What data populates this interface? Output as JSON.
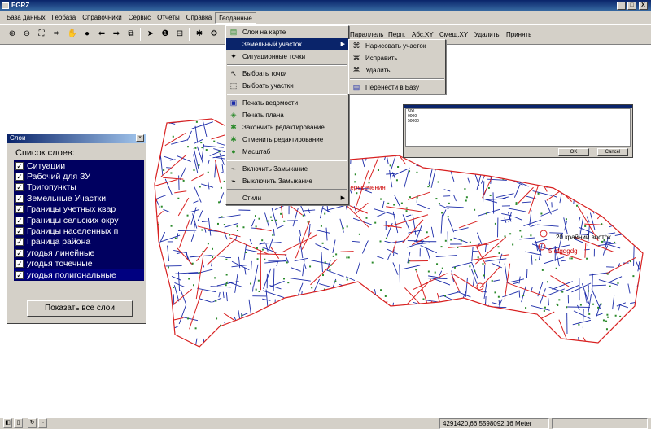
{
  "window": {
    "title": "EGRZ",
    "min_label": "_",
    "max_label": "□",
    "close_label": "X"
  },
  "menubar": [
    "База данных",
    "Геобаза",
    "Справочники",
    "Сервис",
    "Отчеты",
    "Справка",
    "Геоданные"
  ],
  "toolbar": {
    "buttons": [
      "Параллель",
      "Перп.",
      "Абс.XY",
      "Смещ.XY",
      "Удалить",
      "Принять"
    ]
  },
  "geodata_menu": [
    {
      "label": "Слои на карте",
      "icon": "layers-icon"
    },
    {
      "label": "Земельный участок",
      "icon": "",
      "submenu": true
    },
    {
      "label": "Ситуационные точки",
      "icon": "point-icon"
    },
    {
      "label": "Выбрать точки",
      "icon": "select-points-icon"
    },
    {
      "label": "Выбрать участки",
      "icon": "select-parcels-icon"
    },
    {
      "label": "Печать ведомости",
      "icon": "print-icon"
    },
    {
      "label": "Печать плана",
      "icon": "print-plan-icon"
    },
    {
      "label": "Закончить редактирование",
      "icon": "finish-edit-icon"
    },
    {
      "label": "Отменить редактирование",
      "icon": "cancel-edit-icon"
    },
    {
      "label": "Масштаб",
      "icon": "globe-icon"
    },
    {
      "label": "Включить Замыкание",
      "icon": "snap-on-icon"
    },
    {
      "label": "Выключить Замыкание",
      "icon": "snap-off-icon"
    },
    {
      "label": "Стили",
      "icon": "",
      "submenu": true
    }
  ],
  "parcel_submenu": [
    {
      "label": "Нарисовать участок"
    },
    {
      "label": "Исправить"
    },
    {
      "label": "Удалить"
    },
    {
      "label": "Перенести в Базу"
    }
  ],
  "layers_panel": {
    "title": "Слои",
    "list_label": "Список слоев:",
    "layers": [
      "Ситуации",
      "Рабочий для ЗУ",
      "Тригопункты",
      "Земельные Участки",
      "Границы учетных квар",
      "Границы сельских окру",
      "Границы населенных п",
      "Граница района",
      "угодья линейные",
      "угодья точечные",
      "угодья полигональные"
    ],
    "show_all_button": "Показать все слои"
  },
  "dialog": {
    "lines": [
      "500",
      "0000",
      "50000"
    ],
    "ok": "OK",
    "cancel": "Cancel"
  },
  "map_labels": {
    "intersection": "пересечения",
    "east": "20 крайний восток",
    "code": "5 dfgdgdg"
  },
  "statusbar": {
    "coordinates": "4291420,66 5598092,16 Meter"
  },
  "colors": {
    "parcel_blue": "#1a2aa8",
    "boundary_red": "#d82020",
    "point_green": "#2a8a2a",
    "menu_highlight": "#0a246a",
    "layers_bg": "#000060"
  }
}
